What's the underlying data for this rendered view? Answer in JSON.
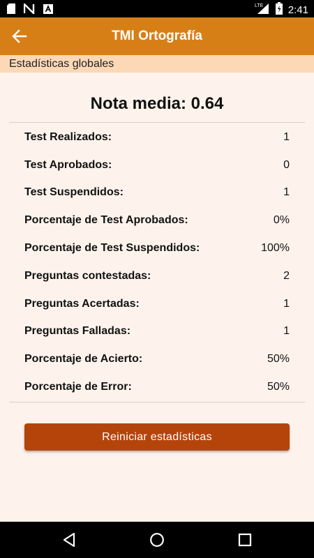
{
  "status_bar": {
    "time": "2:41",
    "network": "LTE",
    "icons": [
      "sd-card-icon",
      "n-icon",
      "a-icon",
      "signal-icon",
      "battery-icon"
    ]
  },
  "app_bar": {
    "title": "TMI Ortografía",
    "back_icon": "arrow-left-icon"
  },
  "section": {
    "title": "Estadísticas globales"
  },
  "average": {
    "label": "Nota media:",
    "value": "0.64"
  },
  "stats": [
    {
      "label": "Test Realizados:",
      "value": "1"
    },
    {
      "label": "Test Aprobados:",
      "value": "0"
    },
    {
      "label": "Test Suspendidos:",
      "value": "1"
    },
    {
      "label": "Porcentaje de Test Aprobados:",
      "value": "0%"
    },
    {
      "label": "Porcentaje de Test Suspendidos:",
      "value": "100%"
    },
    {
      "label": "Preguntas contestadas:",
      "value": "2"
    },
    {
      "label": "Preguntas Acertadas:",
      "value": "1"
    },
    {
      "label": "Preguntas Falladas:",
      "value": "1"
    },
    {
      "label": "Porcentaje de Acierto:",
      "value": "50%"
    },
    {
      "label": "Porcentaje de Error:",
      "value": "50%"
    }
  ],
  "reset_button": {
    "label": "Reiniciar estadísticas"
  },
  "colors": {
    "app_bar": "#d77f17",
    "section_header": "#fcd8b7",
    "background": "#fdf3ec",
    "button": "#b5440b"
  },
  "nav_bar": {
    "icons": [
      "back-triangle-icon",
      "home-circle-icon",
      "recents-square-icon"
    ]
  }
}
